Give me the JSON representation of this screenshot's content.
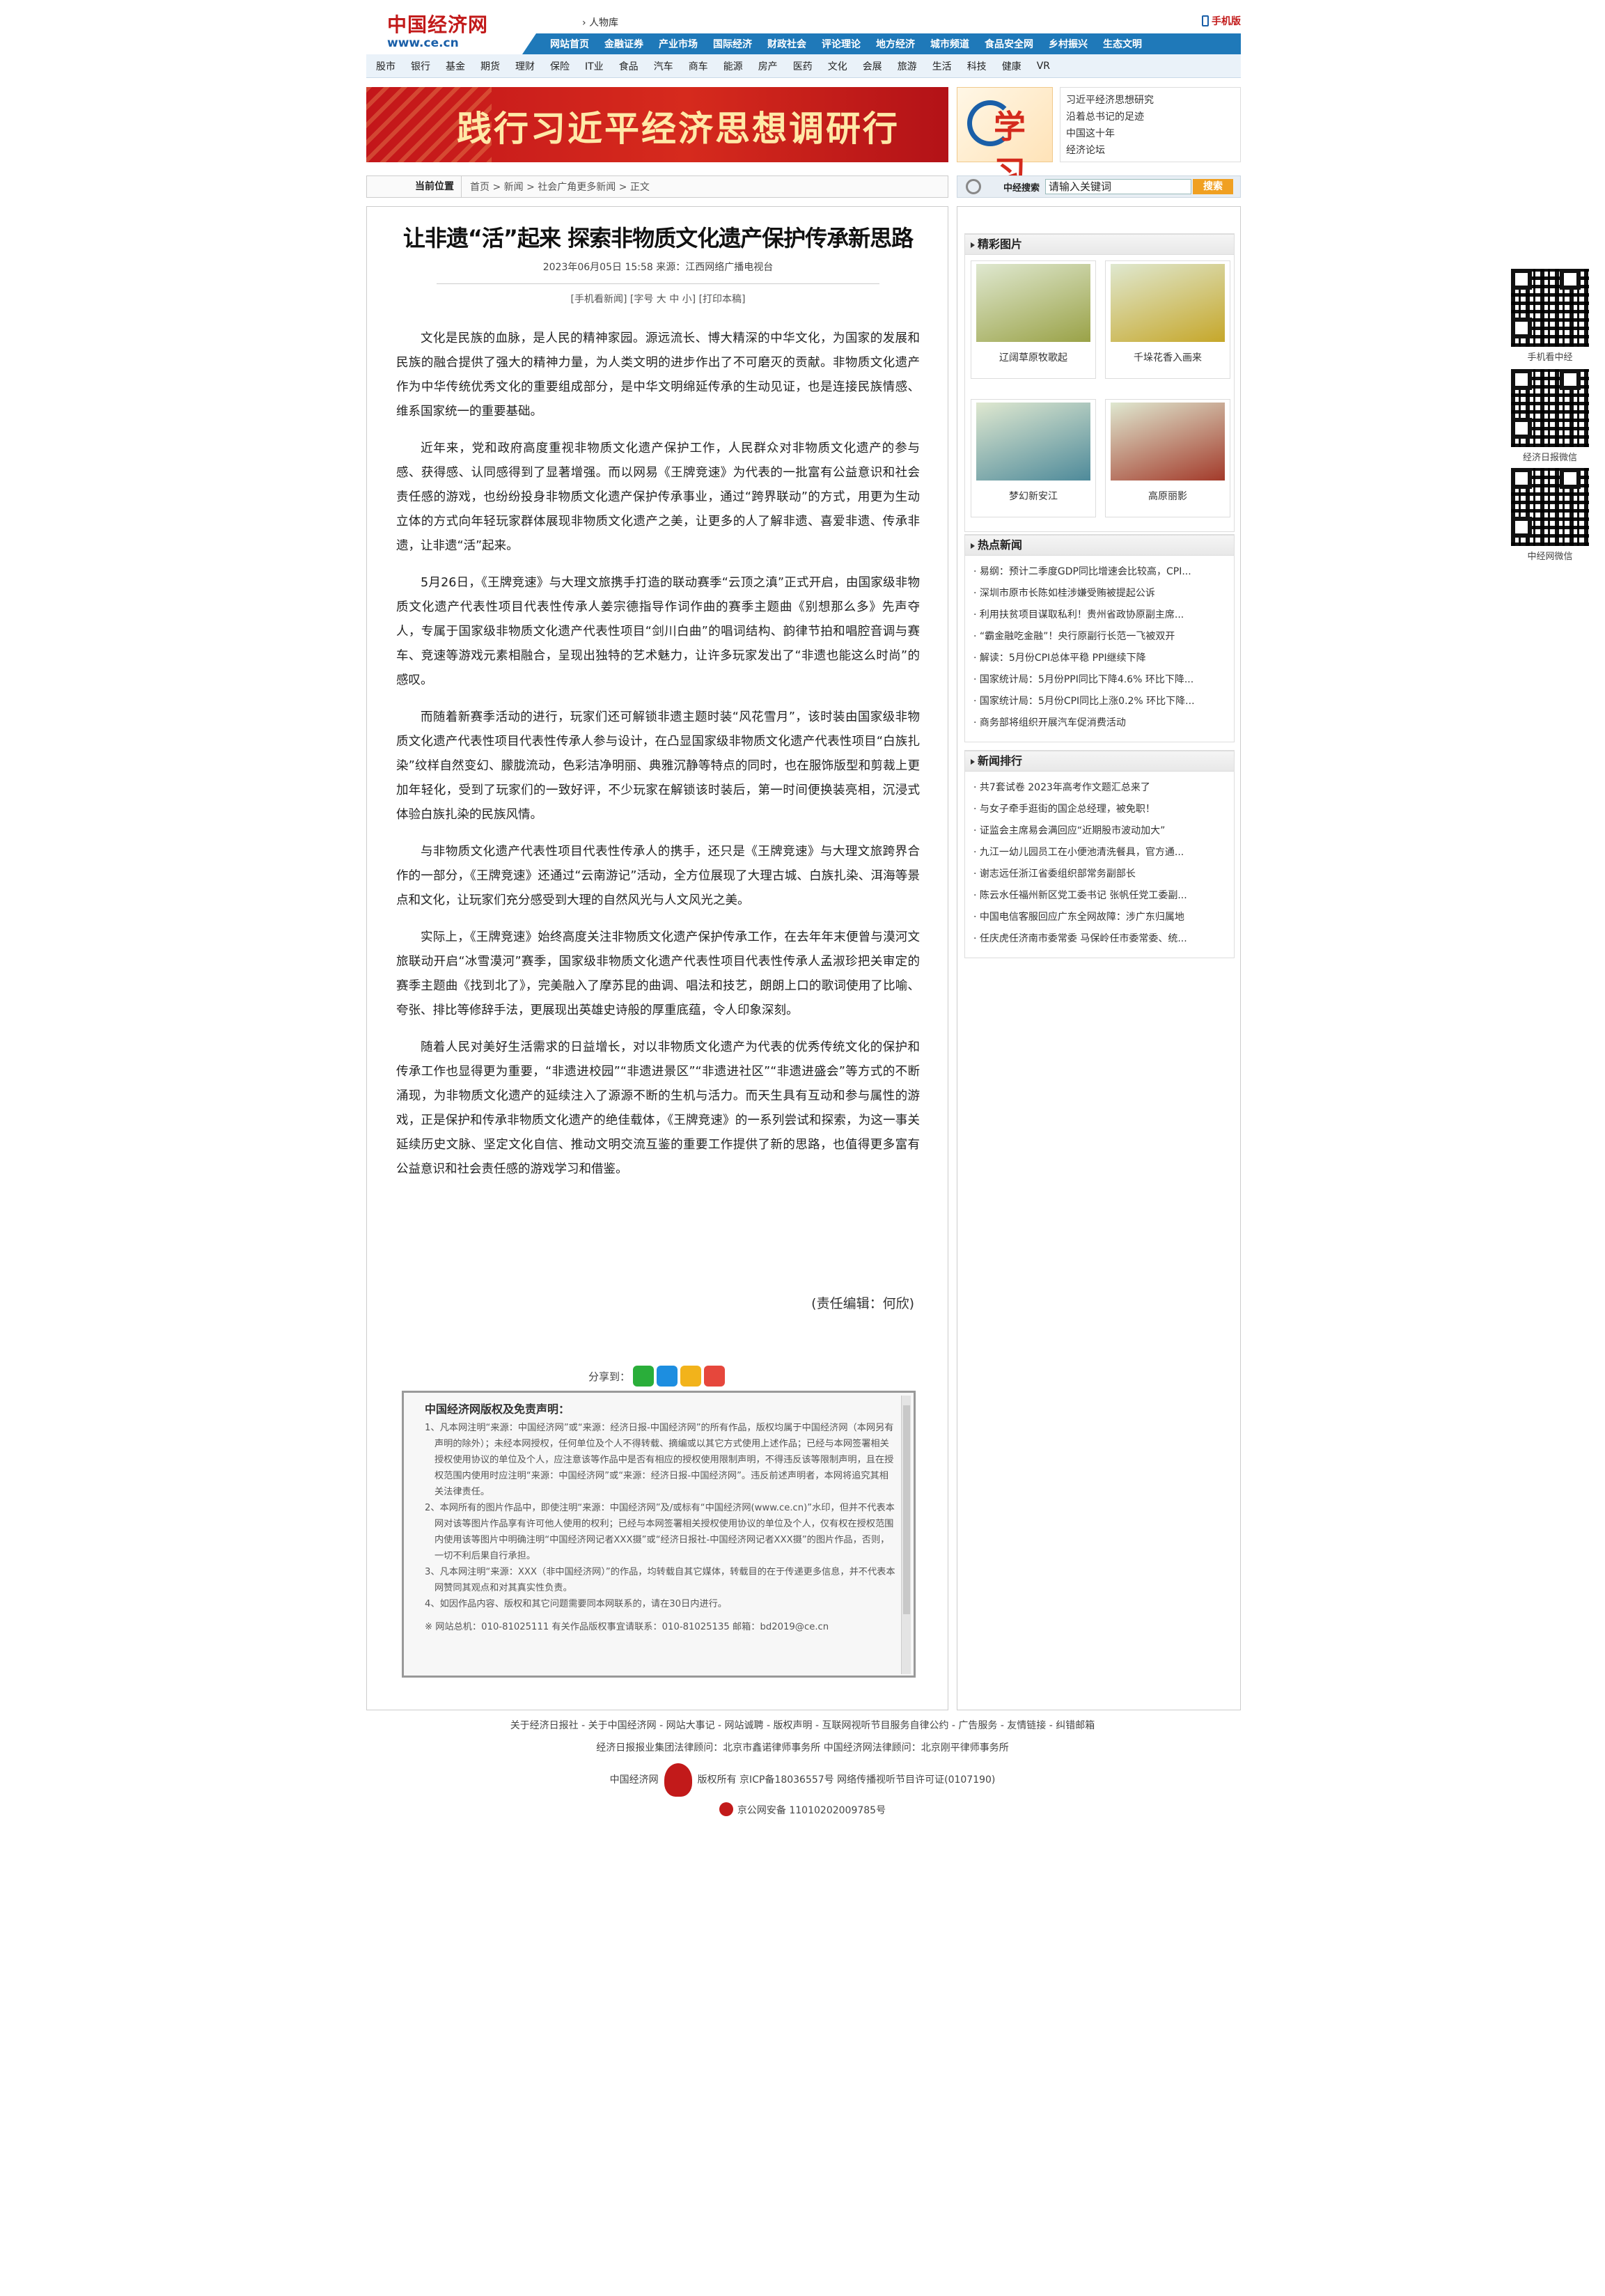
{
  "header": {
    "logo_cn": "中国经济网",
    "logo_url": "www.ce.cn",
    "top_link": "人物库",
    "mobile": "手机版"
  },
  "nav1": [
    "网站首页",
    "金融证券",
    "产业市场",
    "国际经济",
    "财政社会",
    "评论理论",
    "地方经济",
    "城市频道",
    "食品安全网",
    "乡村振兴",
    "生态文明"
  ],
  "nav2": [
    "股市",
    "银行",
    "基金",
    "期货",
    "理财",
    "保险",
    "IT业",
    "食品",
    "汽车",
    "商车",
    "能源",
    "房产",
    "医药",
    "文化",
    "会展",
    "旅游",
    "生活",
    "科技",
    "健康",
    "VR"
  ],
  "banner": {
    "text": "践行习近平经济思想调研行",
    "xuexi": "学习"
  },
  "right_links": [
    "习近平经济思想研究",
    "沿着总书记的足迹",
    "中国这十年",
    "经济论坛"
  ],
  "crumb": {
    "label": "当前位置",
    "path": "首页 > 新闻 > 社会广角更多新闻 > 正文"
  },
  "search": {
    "label": "中经搜索",
    "placeholder": "请输入关键词",
    "button": "搜索"
  },
  "article": {
    "title": "让非遗“活”起来 探索非物质文化遗产保护传承新思路",
    "meta": "2023年06月05日 15:58   来源：江西网络广播电视台",
    "tools": "[手机看新闻]   [字号 大 中 小]   [打印本稿]",
    "paragraphs": [
      "文化是民族的血脉，是人民的精神家园。源远流长、博大精深的中华文化，为国家的发展和民族的融合提供了强大的精神力量，为人类文明的进步作出了不可磨灭的贡献。非物质文化遗产作为中华传统优秀文化的重要组成部分，是中华文明绵延传承的生动见证，也是连接民族情感、维系国家统一的重要基础。",
      "近年来，党和政府高度重视非物质文化遗产保护工作，人民群众对非物质文化遗产的参与感、获得感、认同感得到了显著增强。而以网易《王牌竞速》为代表的一批富有公益意识和社会责任感的游戏，也纷纷投身非物质文化遗产保护传承事业，通过“跨界联动”的方式，用更为生动立体的方式向年轻玩家群体展现非物质文化遗产之美，让更多的人了解非遗、喜爱非遗、传承非遗，让非遗“活”起来。",
      "5月26日，《王牌竞速》与大理文旅携手打造的联动赛季“云顶之滇”正式开启，由国家级非物质文化遗产代表性项目代表性传承人姜宗德指导作词作曲的赛季主题曲《别想那么多》先声夺人，专属于国家级非物质文化遗产代表性项目“剑川白曲”的唱词结构、韵律节拍和唱腔音调与赛车、竞速等游戏元素相融合，呈现出独特的艺术魅力，让许多玩家发出了“非遗也能这么时尚”的感叹。",
      "而随着新赛季活动的进行，玩家们还可解锁非遗主题时装“风花雪月”，该时装由国家级非物质文化遗产代表性项目代表性传承人参与设计，在凸显国家级非物质文化遗产代表性项目“白族扎染”纹样自然变幻、朦胧流动，色彩洁净明丽、典雅沉静等特点的同时，也在服饰版型和剪裁上更加年轻化，受到了玩家们的一致好评，不少玩家在解锁该时装后，第一时间便换装亮相，沉浸式体验白族扎染的民族风情。",
      "与非物质文化遗产代表性项目代表性传承人的携手，还只是《王牌竞速》与大理文旅跨界合作的一部分，《王牌竞速》还通过“云南游记”活动，全方位展现了大理古城、白族扎染、洱海等景点和文化，让玩家们充分感受到大理的自然风光与人文风光之美。",
      "实际上，《王牌竞速》始终高度关注非物质文化遗产保护传承工作，在去年年末便曾与漠河文旅联动开启“冰雪漠河”赛季，国家级非物质文化遗产代表性项目代表性传承人孟淑珍把关审定的赛季主题曲《找到北了》，完美融入了摩苏昆的曲调、唱法和技艺，朗朗上口的歌词使用了比喻、夸张、排比等修辞手法，更展现出英雄史诗般的厚重底蕴，令人印象深刻。",
      "随着人民对美好生活需求的日益增长，对以非物质文化遗产为代表的优秀传统文化的保护和传承工作也显得更为重要，“非遗进校园”“非遗进景区”“非遗进社区”“非遗进盛会”等方式的不断涌现，为非物质文化遗产的延续注入了源源不断的生机与活力。而天生具有互动和参与属性的游戏，正是保护和传承非物质文化遗产的绝佳载体，《王牌竞速》的一系列尝试和探索，为这一事关延续历史文脉、坚定文化自信、推动文明交流互鉴的重要工作提供了新的思路，也值得更多富有公益意识和社会责任感的游戏学习和借鉴。"
    ],
    "editor": "(责任编辑：何欣)",
    "share": "分享到："
  },
  "copyright": {
    "title": "中国经济网版权及免责声明：",
    "items": [
      "1、凡本网注明“来源：中国经济网”或“来源：经济日报-中国经济网”的所有作品，版权均属于中国经济网（本网另有声明的除外）；未经本网授权，任何单位及个人不得转载、摘编或以其它方式使用上述作品；已经与本网签署相关授权使用协议的单位及个人，应注意该等作品中是否有相应的授权使用限制声明，不得违反该等限制声明，且在授权范围内使用时应注明“来源：中国经济网”或“来源：经济日报-中国经济网”。违反前述声明者，本网将追究其相关法律责任。",
      "2、本网所有的图片作品中，即使注明“来源：中国经济网”及/或标有“中国经济网(www.ce.cn)”水印，但并不代表本网对该等图片作品享有许可他人使用的权利；已经与本网签署相关授权使用协议的单位及个人，仅有权在授权范围内使用该等图片中明确注明“中国经济网记者XXX摄”或“经济日报社-中国经济网记者XXX摄”的图片作品，否则，一切不利后果自行承担。",
      "3、凡本网注明“来源：XXX（非中国经济网）”的作品，均转载自其它媒体，转载目的在于传递更多信息，并不代表本网赞同其观点和对其真实性负责。",
      "4、如因作品内容、版权和其它问题需要同本网联系的，请在30日内进行。"
    ],
    "contact": "※ 网站总机：010-81025111 有关作品版权事宜请联系：010-81025135 邮箱：bd2019@ce.cn"
  },
  "side": {
    "pics_title": "精彩图片",
    "pics": [
      {
        "caption": "辽阔草原牧歌起",
        "color": "#9aa247"
      },
      {
        "caption": "千垛花香入画来",
        "color": "#c6a72a"
      },
      {
        "caption": "梦幻新安江",
        "color": "#4e8a9a"
      },
      {
        "caption": "高原丽影",
        "color": "#a33a2a"
      }
    ],
    "hot_title": "热点新闻",
    "hot": [
      "易纲：预计二季度GDP同比增速会比较高，CPI...",
      "深圳市原市长陈如桂涉嫌受贿被提起公诉",
      "利用扶贫项目谋取私利！贵州省政协原副主席...",
      "“霸金融吃金融”！央行原副行长范一飞被双开",
      "解读：5月份CPI总体平稳 PPI继续下降",
      "国家统计局：5月份PPI同比下降4.6% 环比下降...",
      "国家统计局：5月份CPI同比上涨0.2% 环比下降...",
      "商务部将组织开展汽车促消费活动"
    ],
    "rank_title": "新闻排行",
    "rank": [
      "共7套试卷 2023年高考作文题汇总来了",
      "与女子牵手逛街的国企总经理，被免职！",
      "证监会主席易会满回应“近期股市波动加大”",
      "九江一幼儿园员工在小便池清洗餐具，官方通...",
      "谢志远任浙江省委组织部常务副部长",
      "陈云水任福州新区党工委书记 张帆任党工委副...",
      "中国电信客服回应广东全网故障：涉广东归属地",
      "任庆虎任济南市委常委 马保岭任市委常委、统..."
    ]
  },
  "qr": [
    "手机看中经",
    "经济日报微信",
    "中经网微信"
  ],
  "footer": {
    "links": "关于经济日报社 - 关于中国经济网 - 网站大事记 - 网站诚聘 - 版权声明 - 互联网视听节目服务自律公约 - 广告服务 - 友情链接 - 纠错邮箱",
    "law": "经济日报报业集团法律顾问：北京市鑫诺律师事务所    中国经济网法律顾问：北京刚平律师事务所",
    "icp_left": "中国经济网",
    "icp_right": "版权所有 京ICP备18036557号 网络传播视听节目许可证(0107190)",
    "police": "京公网安备 11010202009785号"
  }
}
